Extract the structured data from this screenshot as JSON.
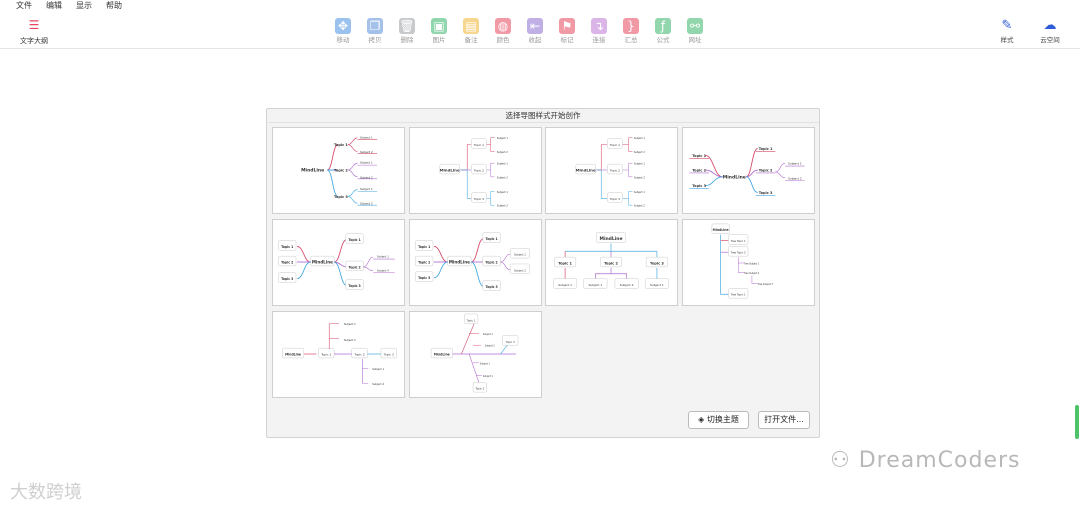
{
  "menu": [
    "文件",
    "编辑",
    "显示",
    "帮助"
  ],
  "outline_label": "文字大纲",
  "toolbar": [
    {
      "label": "移动",
      "icon": "move-icon",
      "color": "#4a90e2",
      "glyph": "✥"
    },
    {
      "label": "拷贝",
      "icon": "copy-icon",
      "color": "#5b8fd9",
      "glyph": "❐"
    },
    {
      "label": "删除",
      "icon": "trash-icon",
      "color": "#9aa0a6",
      "glyph": "🗑"
    },
    {
      "label": "图片",
      "icon": "image-icon",
      "color": "#3ab56b",
      "glyph": "▣"
    },
    {
      "label": "备注",
      "icon": "note-icon",
      "color": "#f2b632",
      "glyph": "▤"
    },
    {
      "label": "颜色",
      "icon": "palette-icon",
      "color": "#e8475f",
      "glyph": "◍"
    },
    {
      "label": "收起",
      "icon": "collapse-icon",
      "color": "#8e6fd1",
      "glyph": "⇤"
    },
    {
      "label": "标记",
      "icon": "flag-icon",
      "color": "#e8475f",
      "glyph": "⚑"
    },
    {
      "label": "连接",
      "icon": "connect-icon",
      "color": "#c07ad6",
      "glyph": "↴"
    },
    {
      "label": "汇总",
      "icon": "summary-icon",
      "color": "#e8475f",
      "glyph": "}"
    },
    {
      "label": "公式",
      "icon": "formula-icon",
      "color": "#3ab56b",
      "glyph": "ƒ"
    },
    {
      "label": "网址",
      "icon": "link-icon",
      "color": "#3ab56b",
      "glyph": "⚯"
    }
  ],
  "right_tools": [
    {
      "label": "样式",
      "icon": "style-brush-icon",
      "color": "#2f5bd8"
    },
    {
      "label": "云空间",
      "icon": "cloud-upload-icon",
      "color": "#2f5bd8"
    }
  ],
  "panel": {
    "title": "选择导图样式开始创作",
    "switch_theme": "切换主题",
    "open_file": "打开文件..."
  },
  "templates": {
    "root": "MindLine",
    "topics": [
      "Topic 1",
      "Topic 2",
      "Topic 3"
    ],
    "subject": "Subject 1",
    "subjects": [
      "Subject 1",
      "Subject 2"
    ],
    "tree_topics": [
      "Tree Topic 1",
      "Tree Topic 2"
    ],
    "tree_subjects": [
      "Tree Subject 1",
      "Tree Subject 2",
      "Tree Subject 3"
    ],
    "subject4": "Subject 4",
    "topic4": "Topic 4"
  },
  "colors": {
    "red": "#d64a6a",
    "purple": "#b06ad1",
    "blue": "#44a8e0",
    "accent": "#2f5bd8"
  },
  "watermark": "DreamCoders",
  "watermark2": "大数跨境"
}
